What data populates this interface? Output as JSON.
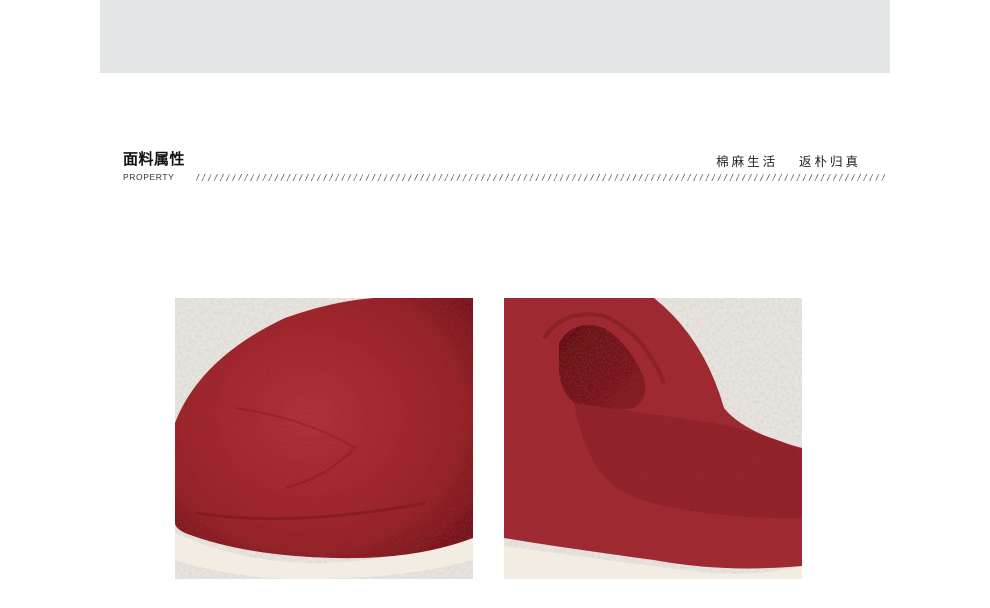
{
  "header": {
    "title_cn": "面料属性",
    "title_en": "PROPERTY",
    "slogan": "棉麻生活   返朴归真"
  },
  "images": [
    {
      "name": "slipper-toe-closeup",
      "subject": "red terry slipper toe close-up",
      "color": "#a32a30"
    },
    {
      "name": "slipper-side-view",
      "subject": "red terry slipper open toe side view",
      "color": "#a32a30"
    }
  ],
  "colors": {
    "top_band": "#e3e6e7",
    "fabric_red": "#a32a30",
    "fabric_dark": "#6e1519",
    "sole_cream": "#f3ece3"
  }
}
